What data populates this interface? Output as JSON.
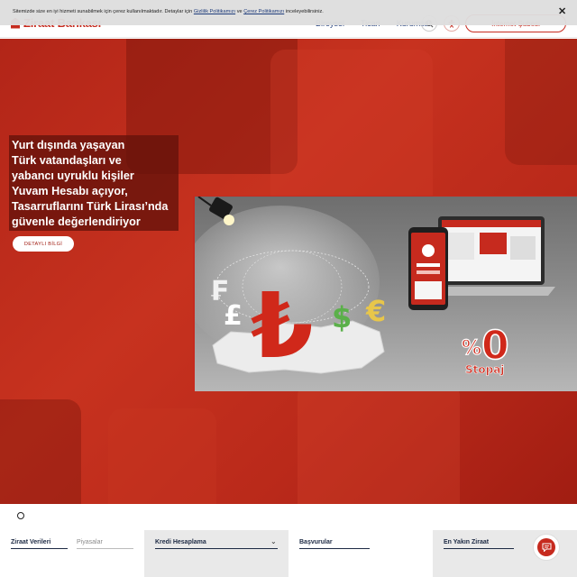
{
  "cookie": {
    "text_before": "Sitemizde size en iyi hizmeti sunabilmek için çerez kullanılmaktadır. Detaylar için ",
    "privacy_link": "Gizlilik Politikamızı",
    "and_text": " ve ",
    "cookie_link": "Çerez Politikamızı",
    "text_after": " inceleyebilirsiniz.",
    "close_label": "✕"
  },
  "header": {
    "logo_text": "Ziraat Bankası",
    "nav": [
      "Bireysel",
      "Ticari",
      "Kurumsal"
    ],
    "search_icon": "search-icon",
    "accessibility_icon": "accessibility-icon",
    "netbank_label": "İnternet Şubesi"
  },
  "hero": {
    "headline_lines": [
      "Yurt dışında yaşayan",
      "Türk vatandaşları ve",
      "yabancı uyruklu kişiler",
      "Yuvam Hesabı açıyor,",
      "Tasarruflarını Türk Lirası’nda",
      "güvenle değerlendiriyor"
    ],
    "detail_button": "DETAYLI BİLGİ",
    "promo": {
      "currency_symbols": [
        "₺",
        "£",
        "$",
        "€",
        "₣"
      ],
      "stopaj_number": "0",
      "stopaj_percent": "%",
      "stopaj_label": "Stopaj",
      "colors": {
        "lira": "#d0281a",
        "euro": "#e8c64a",
        "dollar": "#5bb04a",
        "pound": "#ffffff"
      }
    }
  },
  "bottom": {
    "tabs": [
      {
        "label": "Ziraat Verileri",
        "active": true
      },
      {
        "label": "Piyasalar",
        "active": false
      }
    ],
    "kredi_label": "Kredi Hesaplama",
    "basvurular_label": "Başvurular",
    "en_yakin_label": "En Yakın Ziraat",
    "chat_icon": "chat-icon"
  },
  "colors": {
    "brand_red": "#c62a1e",
    "navy": "#1d3b7a"
  }
}
